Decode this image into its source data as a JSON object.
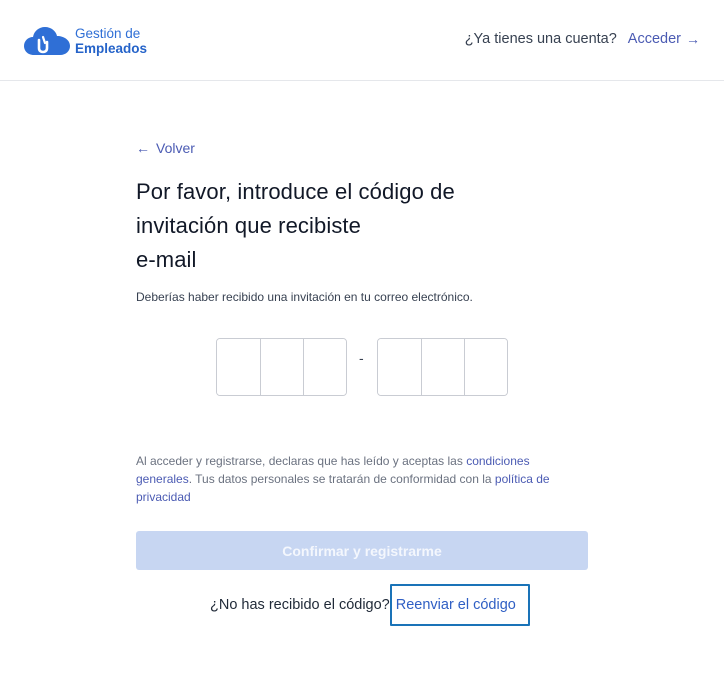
{
  "header": {
    "logo_line1": "Gestión de",
    "logo_line2": "Empleados",
    "account_question": "¿Ya tienes una cuenta?",
    "login_label": "Acceder",
    "login_arrow": "→"
  },
  "main": {
    "back_arrow": "←",
    "back_label": "Volver",
    "title_line1": "Por favor, introduce el código de",
    "title_line2": "invitación que recibiste",
    "title_line3": "e-mail",
    "subtitle": "Deberías haber recibido una invitación en tu correo electrónico.",
    "code_separator": "-",
    "code_cells_group1": [
      "",
      "",
      ""
    ],
    "code_cells_group2": [
      "",
      "",
      ""
    ],
    "terms_prefix": "Al acceder y registrarse, declaras que has leído y aceptas las",
    "terms_link1": "condiciones generales",
    "terms_middle": ". Tus datos personales se tratarán de conformidad con la",
    "terms_link2": "política de privacidad",
    "confirm_label": "Confirmar y registrarme",
    "resend_question": "¿No has recibido el código?",
    "resend_label": "Reenviar el código"
  },
  "colors": {
    "brand_blue": "#2563c9",
    "link": "#4b5bb3",
    "button_disabled_bg": "#c7d6f2",
    "focus_outline": "#1a73b8"
  },
  "icons": {
    "logo": "cloud-logo-icon",
    "login_arrow": "arrow-right-icon",
    "back_arrow": "arrow-left-icon"
  }
}
